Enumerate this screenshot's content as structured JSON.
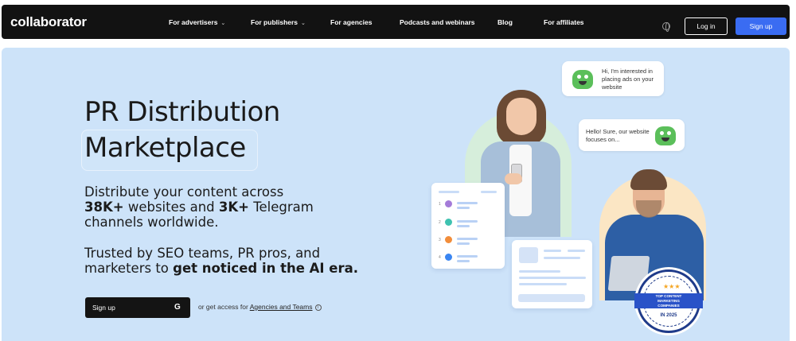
{
  "nav": {
    "logo": "collaborator",
    "items": [
      "For advertisers",
      "For publishers",
      "For agencies",
      "Podcasts and webinars",
      "Blog",
      "For affiliates"
    ],
    "login": "Log in",
    "signup": "Sign up"
  },
  "hero": {
    "title_line1": "PR Distribution",
    "title_line2": "Marketplace",
    "para1_line1": "Distribute your content across",
    "para1_line2_bold1": "38K+",
    "para1_line2_mid": " websites and ",
    "para1_line2_bold2": "3K+",
    "para1_line2_end": " Telegram",
    "para1_line3": "channels worldwide.",
    "para2_line1": "Trusted by SEO teams, PR pros, and",
    "para2_line2_start": "marketers to ",
    "para2_line2_bold": "get noticed in the AI era.",
    "signup_button": "Sign up",
    "access_text": "or get access for ",
    "access_link": "Agencies and Teams"
  },
  "illustration": {
    "bubble1": "Hi, I'm interested in placing ads on your website",
    "bubble2": "Hello! Sure, our website focuses on...",
    "rows": [
      "1",
      "2",
      "3",
      "4"
    ],
    "badge_ribbon_line1": "TOP CONTENT",
    "badge_ribbon_line2": "MARKETING",
    "badge_ribbon_line3": "COMPANIES",
    "badge_year": "IN 2025"
  },
  "colors": {
    "accent": "#3a6cf2",
    "hero_bg": "#cde3f9",
    "nav_bg": "#121212",
    "row_dots": [
      "#a47bd8",
      "#3fc2b0",
      "#f28d3a",
      "#3a86f2"
    ]
  },
  "icons": [
    "globe-icon",
    "google-icon",
    "info-icon",
    "chevron-down-icon"
  ]
}
